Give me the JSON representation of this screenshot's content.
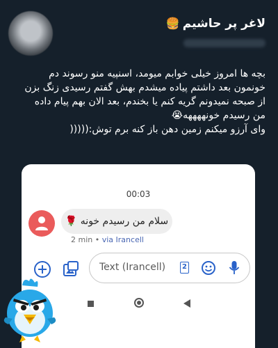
{
  "profile": {
    "display_name": "لاغر پر حاشیم",
    "name_emoji": "🍔"
  },
  "tweet": {
    "lines": [
      "بچه ها امروز خیلی خوابم میومد، اسنپیه منو رسوند دم",
      "خونمون بعد داشتم پیاده میشدم بهش گفتم رسیدی زنگ بزن",
      "از صبحه نمیدونم گریه کنم یا بخندم، بعد الان بهم پیام داده",
      "من رسیدم خونههههه😭",
      "وای آرزو میکنم زمین دهن باز کنه برم توش:((((("
    ]
  },
  "screenshot": {
    "timestamp": "00:03",
    "message_text": "سلام من رسیدم خونه 🌹",
    "message_time": "2 min",
    "message_via": "via Irancell",
    "compose_placeholder": "Text (Irancell)",
    "sim_number": "2"
  },
  "colors": {
    "background": "#15202b",
    "contact_avatar": "#ea5b5b",
    "accent_blue": "#2962c9"
  }
}
